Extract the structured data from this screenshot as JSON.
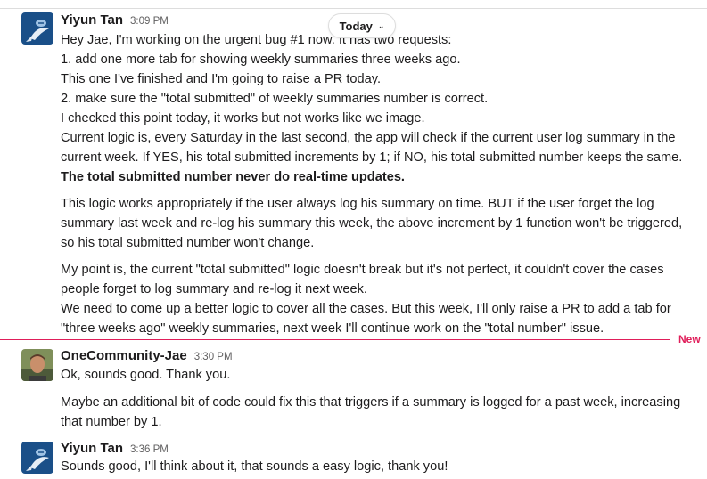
{
  "date_divider": {
    "label": "Today"
  },
  "new_marker": {
    "label": "New"
  },
  "colors": {
    "new": "#e01e5a",
    "name": "#1d1c1d",
    "time": "#616061",
    "avatar_yiyun": "#1a4f88"
  },
  "messages": [
    {
      "author": "Yiyun Tan",
      "time": "3:09 PM",
      "avatar": "yiyun-avatar",
      "lines": [
        "Hey Jae, I'm working on the urgent bug #1 now. It has two requests:",
        " 1.  add one more tab for showing weekly summaries three weeks ago.",
        "This one I've finished and I'm going to raise a PR today.",
        "2. make sure the \"total submitted\" of weekly summaries number is correct.",
        "I checked this point today, it works but not works like we image.",
        "Current logic is, every Saturday in the last second, the app will check if the current user log summary in the",
        "current week. If YES, his total submitted increments by 1; if NO, his total submitted number keeps the same.",
        "The total submitted number never do real-time updates.",
        "This logic works appropriately if the user always log his summary on time. BUT if the user forget the log",
        "summary last week and re-log his summary this week, the above increment by 1 function won't be triggered,",
        "so his total submitted number won't change.",
        "My point is, the current \"total submitted\" logic doesn't break but it's not perfect, it couldn't cover the cases",
        "people forget to log summary and re-log it next week.",
        "We need to come up a better logic to cover all the cases. But this week, I'll only raise a PR to add a tab for",
        "\"three weeks ago\" weekly summaries, next week I'll continue work on the \"total number\" issue."
      ]
    },
    {
      "author": "OneCommunity-Jae",
      "time": "3:30 PM",
      "avatar": "jae-avatar",
      "lines": [
        "Ok, sounds good. Thank you.",
        "Maybe an additional bit of code could fix this that triggers if a summary is logged for a past week, increasing",
        "that number by 1."
      ]
    },
    {
      "author": "Yiyun Tan",
      "time": "3:36 PM",
      "avatar": "yiyun-avatar",
      "lines": [
        "Sounds good, I'll think about it, that sounds a easy logic, thank you!"
      ]
    }
  ]
}
